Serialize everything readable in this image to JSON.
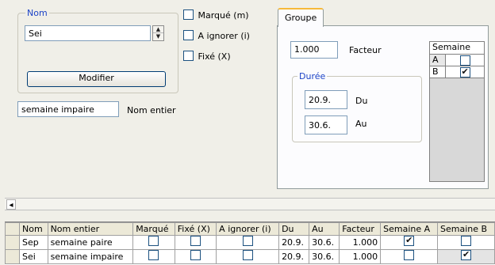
{
  "nom_group": {
    "legend": "Nom",
    "value": "Sei",
    "modify_button": "Modifier"
  },
  "nom_entier": {
    "value": "semaine impaire",
    "label": "Nom entier"
  },
  "options": {
    "marque": {
      "label": "Marqué (m)",
      "checked": false
    },
    "ignorer": {
      "label": "A ignorer (i)",
      "checked": false
    },
    "fixe": {
      "label": "Fixé (X)",
      "checked": false
    }
  },
  "groupe_tab": {
    "label": "Groupe",
    "facteur_value": "1.000",
    "facteur_label": "Facteur",
    "duree_legend": "Durée",
    "du_value": "20.9.",
    "du_label": "Du",
    "au_value": "30.6.",
    "au_label": "Au"
  },
  "semaine_table": {
    "header": "Semaine",
    "rows": [
      {
        "name": "A",
        "checked": false
      },
      {
        "name": "B",
        "checked": true
      }
    ]
  },
  "scroll": {
    "left_arrow": "◂"
  },
  "grid": {
    "columns": [
      "Nom",
      "Nom entier",
      "Marqué",
      "Fixé (X)",
      "A ignorer (i)",
      "Du",
      "Au",
      "Facteur",
      "Semaine A",
      "Semaine B"
    ],
    "rows": [
      {
        "nom": "Sep",
        "nom_entier": "semaine paire",
        "marque": false,
        "fixe": false,
        "ignorer": false,
        "du": "20.9.",
        "au": "30.6.",
        "facteur": "1.000",
        "semaine_a": true,
        "semaine_b": false
      },
      {
        "nom": "Sei",
        "nom_entier": "semaine impaire",
        "marque": false,
        "fixe": false,
        "ignorer": false,
        "du": "20.9.",
        "au": "30.6.",
        "facteur": "1.000",
        "semaine_a": false,
        "semaine_b": true
      }
    ]
  },
  "colors": {
    "legend": "#1c43c7",
    "tab_accent": "#f6b93b",
    "background": "#f0efe8"
  }
}
